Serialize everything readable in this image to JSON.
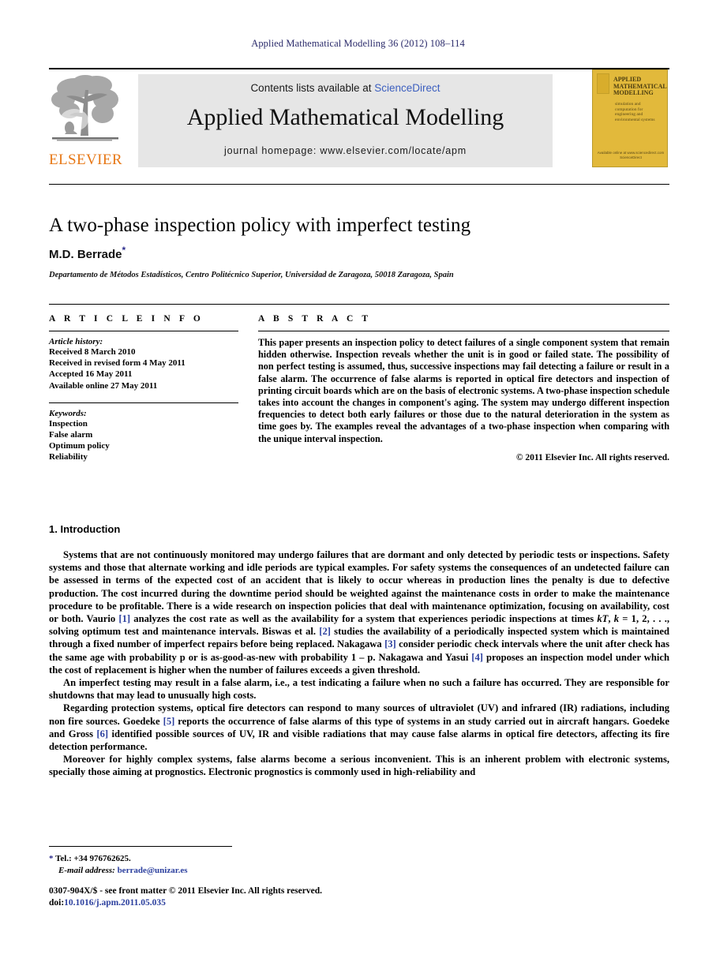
{
  "running_head": "Applied Mathematical Modelling 36 (2012) 108–114",
  "masthead": {
    "publisher_name": "ELSEVIER",
    "contents_prefix": "Contents lists available at ",
    "sciencedirect": "ScienceDirect",
    "journal_name": "Applied Mathematical Modelling",
    "homepage": "journal homepage: www.elsevier.com/locate/apm",
    "cover": {
      "title": "APPLIED MATHEMATICAL MODELLING",
      "subtitle": "simulation and computation for engineering and environmental systems",
      "footer": "Available online at www.sciencedirect.com  ScienceDirect"
    }
  },
  "article": {
    "title": "A two-phase inspection policy with imperfect testing",
    "author": "M.D. Berrade",
    "author_marker": "*",
    "affiliation": "Departamento de Métodos Estadísticos, Centro Politécnico Superior, Universidad de Zaragoza, 50018 Zaragoza, Spain"
  },
  "article_info": {
    "heading": "A R T I C L E   I N F O",
    "history_label": "Article history:",
    "history": [
      "Received 8 March 2010",
      "Received in revised form 4 May 2011",
      "Accepted 16 May 2011",
      "Available online 27 May 2011"
    ],
    "keywords_label": "Keywords:",
    "keywords": [
      "Inspection",
      "False alarm",
      "Optimum policy",
      "Reliability"
    ]
  },
  "abstract": {
    "heading": "A B S T R A C T",
    "text": "This paper presents an inspection policy to detect failures of a single component system that remain hidden otherwise. Inspection reveals whether the unit is in good or failed state. The possibility of non perfect testing is assumed, thus, successive inspections may fail detecting a failure or result in a false alarm. The occurrence of false alarms is reported in optical fire detectors and inspection of printing circuit boards which are on the basis of electronic systems. A two-phase inspection schedule takes into account the changes in component's aging. The system may undergo different inspection frequencies to detect both early failures or those due to the natural deterioration in the system as time goes by. The examples reveal the advantages of a two-phase inspection when comparing with the unique interval inspection.",
    "copyright": "© 2011 Elsevier Inc. All rights reserved."
  },
  "introduction": {
    "heading": "1. Introduction",
    "p1_a": "Systems that are not continuously monitored may undergo failures that are dormant and only detected by periodic tests or inspections. Safety systems and those that alternate working and idle periods are typical examples. For safety systems the consequences of an undetected failure can be assessed in terms of the expected cost of an accident that is likely to occur whereas in production lines the penalty is due to defective production. The cost incurred during the downtime period should be weighted against the maintenance costs in order to make the maintenance procedure to be profitable. There is a wide research on inspection policies that deal with maintenance optimization, focusing on availability, cost or both. Vaurio ",
    "cite1": "[1]",
    "p1_b": " analyzes the cost rate as well as the availability for a system that experiences periodic inspections at times ",
    "p1_math1": "kT",
    "p1_c": ", ",
    "p1_math2": "k",
    "p1_d": " = 1, 2, . . ., solving optimum test and maintenance intervals. Biswas et al. ",
    "cite2": "[2]",
    "p1_e": " studies the availability of a periodically inspected system which is maintained through a fixed number of imperfect repairs before being replaced. Nakagawa ",
    "cite3": "[3]",
    "p1_f": " consider periodic check intervals where the unit after check has the same age with probability p or is as-good-as-new with probability 1 – p. Nakagawa and Yasui ",
    "cite4": "[4]",
    "p1_g": " proposes an inspection model under which the cost of replacement is higher when the number of failures exceeds a given threshold.",
    "p2": "An imperfect testing may result in a false alarm, i.e., a test indicating a failure when no such a failure has occurred. They are responsible for shutdowns that may lead to unusually high costs.",
    "p3_a": "Regarding protection systems, optical fire detectors can respond to many sources of ultraviolet (UV) and infrared (IR) radiations, including non fire sources. Goedeke ",
    "cite5": "[5]",
    "p3_b": " reports the occurrence of false alarms of this type of systems in an study carried out in aircraft hangars. Goedeke and Gross ",
    "cite6": "[6]",
    "p3_c": " identified possible sources of UV, IR and visible radiations that may cause false alarms in optical fire detectors, affecting its fire detection performance.",
    "p4": "Moreover for highly complex systems, false alarms become a serious inconvenient. This is an inherent problem with electronic systems, specially those aiming at prognostics. Electronic prognostics is commonly used in high-reliability and"
  },
  "footnotes": {
    "star": "*",
    "tel": "Tel.: +34 976762625.",
    "email_label": "E-mail address:",
    "email": "berrade@unizar.es"
  },
  "imprint": {
    "line1": "0307-904X/$ - see front matter © 2011 Elsevier Inc. All rights reserved.",
    "doi_label": "doi:",
    "doi": "10.1016/j.apm.2011.05.035"
  },
  "colors": {
    "link": "#2b3f9e",
    "sciencedirect": "#3c5fbf",
    "elsevier_orange": "#e77817",
    "cover_gold": "#e2b93b",
    "running_head": "#2b2b6b"
  }
}
